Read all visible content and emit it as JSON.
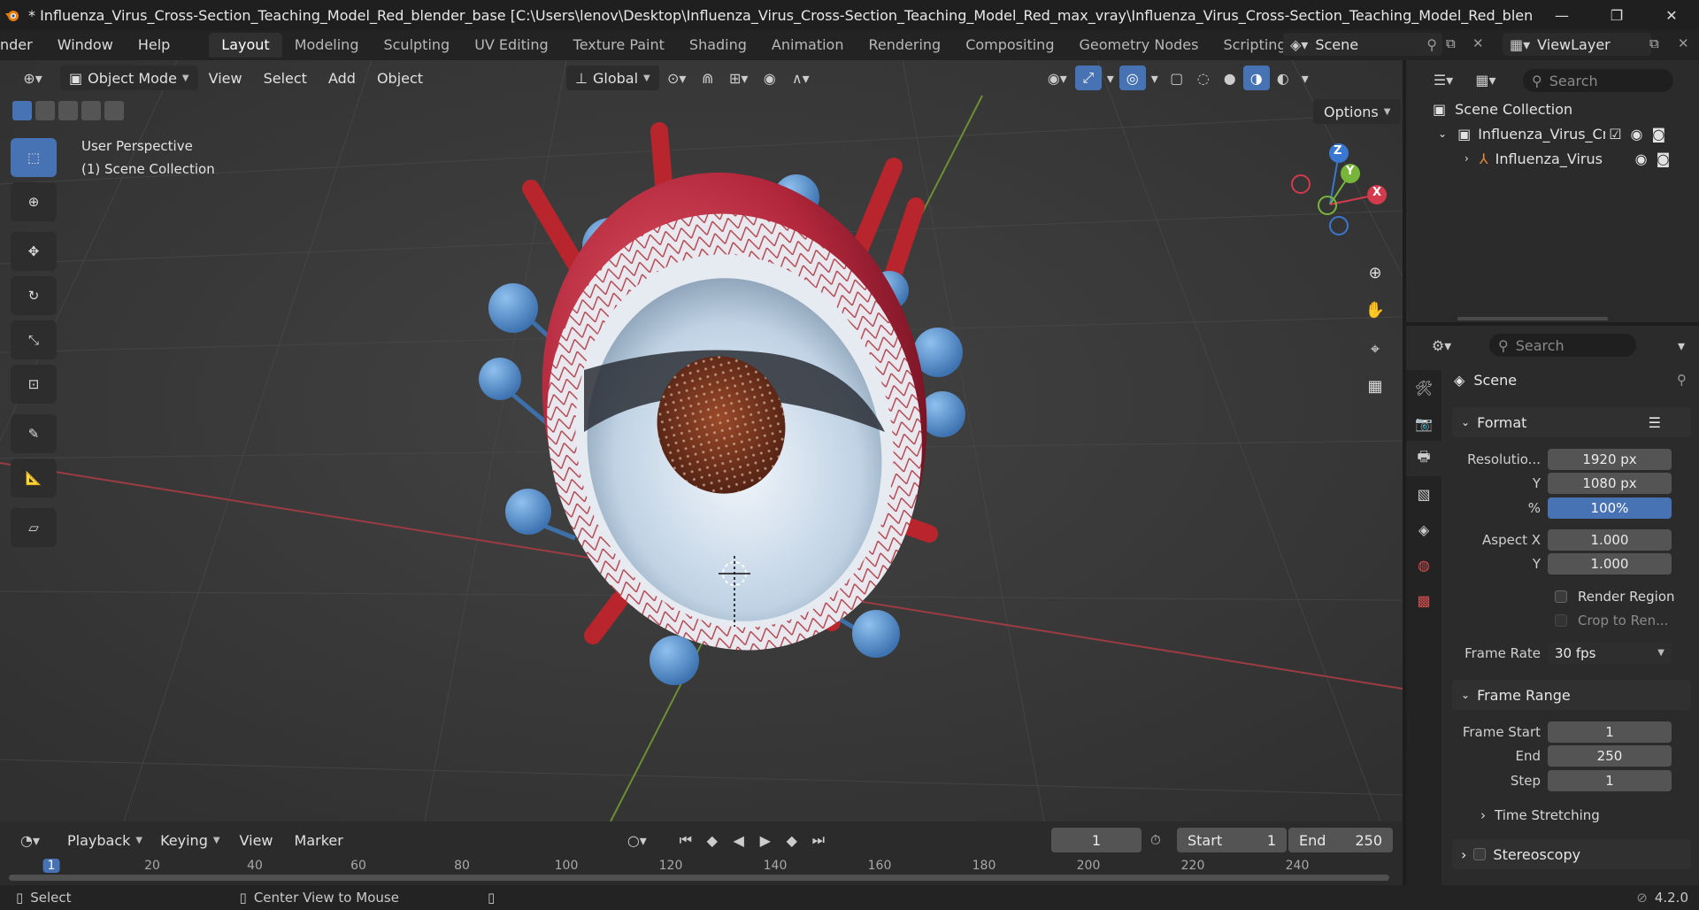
{
  "window": {
    "title": "* Influenza_Virus_Cross-Section_Teaching_Model_Red_blender_base [C:\\Users\\lenov\\Desktop\\Influenza_Virus_Cross-Section_Teaching_Model_Red_max_vray\\Influenza_Virus_Cross-Section_Teaching_Model_Red_blender_base.bl...",
    "controls": [
      "—",
      "❐",
      "✕"
    ]
  },
  "menubar": {
    "menus": [
      "nder",
      "Window",
      "Help"
    ],
    "workspaces": [
      "Layout",
      "Modeling",
      "Sculpting",
      "UV Editing",
      "Texture Paint",
      "Shading",
      "Animation",
      "Rendering",
      "Compositing",
      "Geometry Nodes",
      "Scripting"
    ],
    "active_workspace": "Layout",
    "scene": "Scene",
    "view_layer": "ViewLayer"
  },
  "viewport": {
    "mode": "Object Mode",
    "menus": [
      "View",
      "Select",
      "Add",
      "Object"
    ],
    "transform_orientation": "Global",
    "options_label": "Options",
    "overlay_line1": "User Perspective",
    "overlay_line2": "(1) Scene Collection",
    "gizmo_axes": {
      "x": "X",
      "y": "Y",
      "z": "Z"
    },
    "accent_color": "#4772b3"
  },
  "timeline": {
    "menus": [
      "Playback",
      "Keying",
      "View",
      "Marker"
    ],
    "current_frame": "1",
    "start_label": "Start",
    "start_value": "1",
    "end_label": "End",
    "end_value": "250",
    "ruler_ticks": [
      "1",
      "20",
      "40",
      "60",
      "80",
      "100",
      "120",
      "140",
      "160",
      "180",
      "200",
      "220",
      "240"
    ]
  },
  "statusbar": {
    "select": "Select",
    "center_view": "Center View to Mouse",
    "version": "4.2.0"
  },
  "outliner": {
    "search_placeholder": "Search",
    "root": "Scene Collection",
    "collection": "Influenza_Virus_Cr",
    "object": "Influenza_Virus"
  },
  "properties": {
    "search_placeholder": "Search",
    "context": "Scene",
    "format_panel": "Format",
    "resolution_x_label": "Resolutio...",
    "resolution_x": "1920 px",
    "resolution_y_label": "Y",
    "resolution_y": "1080 px",
    "resolution_pct_label": "%",
    "resolution_pct": "100%",
    "aspect_x_label": "Aspect X",
    "aspect_x": "1.000",
    "aspect_y_label": "Y",
    "aspect_y": "1.000",
    "render_region": "Render Region",
    "crop_to_render": "Crop to Ren...",
    "frame_rate_label": "Frame Rate",
    "frame_rate": "30 fps",
    "frame_range_panel": "Frame Range",
    "frame_start_label": "Frame Start",
    "frame_start": "1",
    "end_label": "End",
    "end": "250",
    "step_label": "Step",
    "step": "1",
    "time_stretching": "Time Stretching",
    "stereoscopy": "Stereoscopy"
  }
}
